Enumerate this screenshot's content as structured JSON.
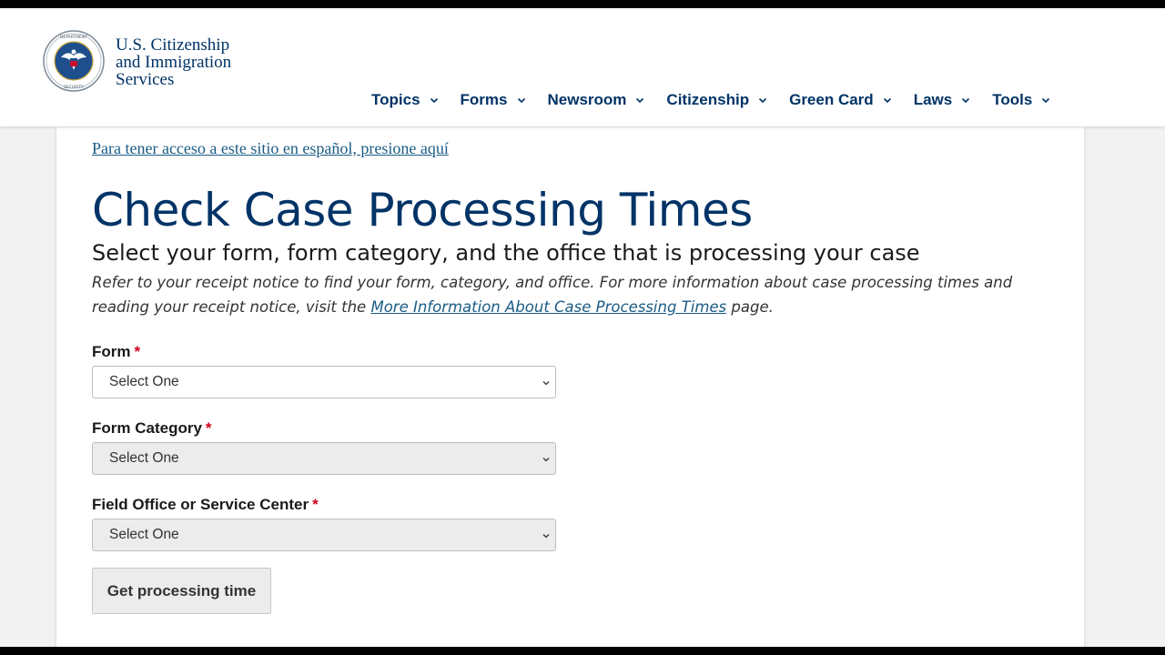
{
  "header": {
    "agency_lines": [
      "U.S. Citizenship",
      "and Immigration",
      "Services"
    ],
    "seal_icon": "dhs-seal-icon"
  },
  "nav": {
    "items": [
      {
        "label": "Topics"
      },
      {
        "label": "Forms"
      },
      {
        "label": "Newsroom"
      },
      {
        "label": "Citizenship"
      },
      {
        "label": "Green Card"
      },
      {
        "label": "Laws"
      },
      {
        "label": "Tools"
      }
    ]
  },
  "main": {
    "spanish_link": "Para tener acceso a este sitio en español, presione aquí",
    "title": "Check Case Processing Times",
    "subtitle": "Select your form, form category, and the office that is processing your case",
    "instructions_before": "Refer to your receipt notice to find your form, category, and office. For more information about case processing times and reading your receipt notice, visit the ",
    "instructions_link": "More Information About Case Processing Times",
    "instructions_after": " page."
  },
  "form": {
    "required_marker": "*",
    "fields": [
      {
        "label": "Form",
        "value": "Select One",
        "disabled": false
      },
      {
        "label": "Form Category",
        "value": "Select One",
        "disabled": true
      },
      {
        "label": "Field Office or Service Center",
        "value": "Select One",
        "disabled": true
      }
    ],
    "submit_label": "Get processing time"
  },
  "colors": {
    "brand_navy": "#003366",
    "link_blue": "#1a5c85",
    "required_red": "#d0021b"
  }
}
